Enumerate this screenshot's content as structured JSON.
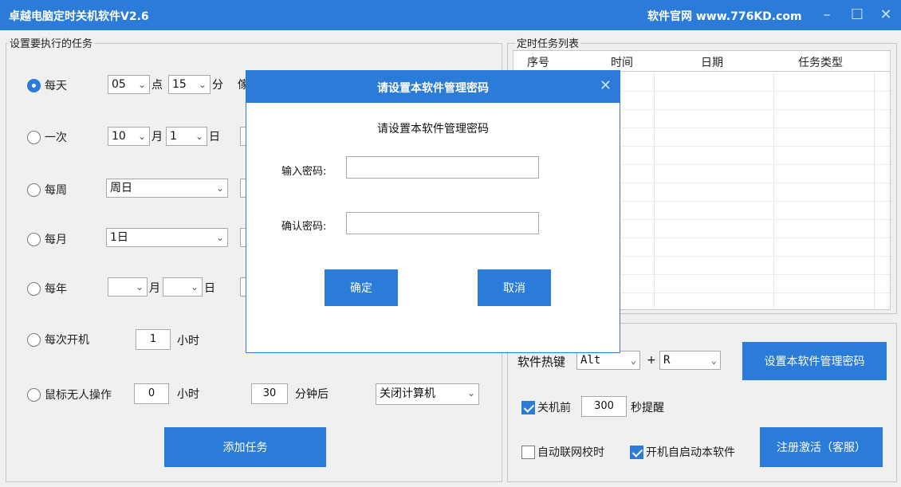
{
  "window": {
    "title": "卓越电脑定时关机软件V2.6",
    "site": "软件官网  www.776KD.com",
    "min_icon": "minimize-icon",
    "max_icon": "maximize-icon",
    "close_icon": "close-icon"
  },
  "tasks": {
    "group_label": "设置要执行的任务",
    "daily": {
      "label": "每天",
      "hour": "05",
      "hour_unit": "点",
      "minute": "15",
      "minute_unit": "分",
      "partial": "傢"
    },
    "once": {
      "label": "一次",
      "month": "10",
      "month_unit": "月",
      "day": "1",
      "day_unit": "日"
    },
    "weekly": {
      "label": "每周",
      "value": "周日"
    },
    "monthly": {
      "label": "每月",
      "value": "1日"
    },
    "yearly": {
      "label": "每年",
      "month": "",
      "month_unit": "月",
      "day": "",
      "day_unit": "日"
    },
    "each_boot": {
      "label": "每次开机",
      "value": "1",
      "unit": "小时"
    },
    "idle": {
      "label": "鼠标无人操作",
      "hours": "0",
      "hours_unit": "小时",
      "minutes": "30",
      "minutes_unit": "分钟后",
      "action": "关闭计算机"
    },
    "add_button": "添加任务"
  },
  "schedule": {
    "group_label": "定时任务列表",
    "columns": [
      "序号",
      "时间",
      "日期",
      "任务类型"
    ]
  },
  "settings": {
    "hotkey_label": "软件热键",
    "hotkey_mod": "Alt",
    "plus": "+",
    "hotkey_key": "R",
    "set_password_button": "设置本软件管理密码",
    "remind_label": "关机前",
    "remind_value": "300",
    "remind_unit": "秒提醒",
    "auto_time_sync": "自动联网校时",
    "auto_start": "开机自启动本软件",
    "register_button": "注册激活（客服）"
  },
  "dialog": {
    "title": "请设置本软件管理密码",
    "heading": "请设置本软件管理密码",
    "password_label": "输入密码:",
    "confirm_label": "确认密码:",
    "password_value": "",
    "confirm_value": "",
    "ok_button": "确定",
    "cancel_button": "取消"
  },
  "colors": {
    "accent": "#2b7cd8"
  }
}
